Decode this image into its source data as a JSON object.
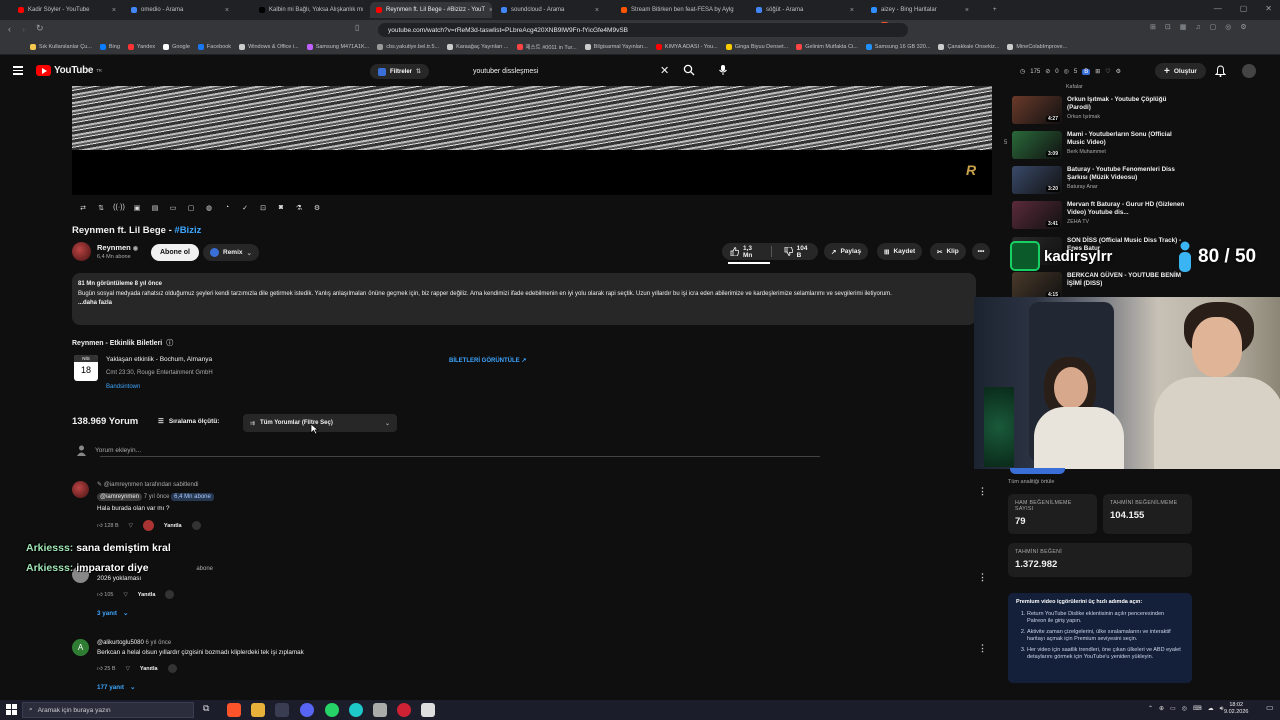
{
  "browser": {
    "tabs": [
      {
        "label": "Kadir Söyler - YouTube",
        "color": "#ff0000"
      },
      {
        "label": "omedio - Arama",
        "color": "#4285f4"
      },
      {
        "label": "Kalbin mi Bağlı, Yoksa Alışkanlık mı ?",
        "color": "#000000"
      },
      {
        "label": "Reynmen ft. Lil Bege - #Bizizz - YouT",
        "color": "#ff0000"
      },
      {
        "label": "soundcloud - Arama",
        "color": "#4285f4"
      },
      {
        "label": "Stream Bitirken ben feat-FESA by Aylg",
        "color": "#ff5500"
      },
      {
        "label": "söğüt - Arama",
        "color": "#4285f4"
      },
      {
        "label": "aizey - Bing Haritalar",
        "color": "#2f8fff"
      }
    ],
    "url": "youtube.com/watch?v=rReM3d-taswlist=PLbreAcg420XNB9lW9Fn-fYicGfe4M9vSB",
    "bookmarks": [
      {
        "label": "Sık Kullanılanlar Çu...",
        "color": "#f2c94c"
      },
      {
        "label": "Bing",
        "color": "#0a7cff"
      },
      {
        "label": "Yandex",
        "color": "#ff3333"
      },
      {
        "label": "Google",
        "color": "#ffffff"
      },
      {
        "label": "Facebook",
        "color": "#1877f2"
      },
      {
        "label": "Windows & Office i...",
        "color": "#cccccc"
      },
      {
        "label": "Samsung M471A1K...",
        "color": "#c060ff"
      },
      {
        "label": "cbs.yakutiye.bel.tr.5...",
        "color": "#999999"
      },
      {
        "label": "Karaağaç Yayınları ...",
        "color": "#cccccc"
      },
      {
        "label": "제스트 #0011 in Tur...",
        "color": "#ff4444"
      },
      {
        "label": "Bilgisarmal Yayınları...",
        "color": "#cccccc"
      },
      {
        "label": "KIMYA ADASI - You...",
        "color": "#ff0000"
      },
      {
        "label": "Ginga Biyuu Denset...",
        "color": "#ffcc00"
      },
      {
        "label": "Gelinim Mutfakta Ci...",
        "color": "#ff4444"
      },
      {
        "label": "Samsung 16 GB 320...",
        "color": "#1e90ff"
      },
      {
        "label": "Çanakkale Onsekiz...",
        "color": "#cccccc"
      },
      {
        "label": "MineColabImprove...",
        "color": "#cccccc"
      }
    ]
  },
  "youtube": {
    "logo_text": "YouTube",
    "logo_country": "TR",
    "filters_label": "Filtreler",
    "search_value": "youtuber dissleşmesi",
    "counts": [
      "175",
      "0",
      "5"
    ],
    "create_label": "Oluştur"
  },
  "video": {
    "title_main": "Reynmen ft. Lil Bege - ",
    "title_tag": "#Biziz",
    "channel": "Reynmen",
    "subscribers": "6,4 Mn abone",
    "subscribe_label": "Abone ol",
    "remix_label": "Remix",
    "likes": "1,3 Mn",
    "dislikes": "104 B",
    "share_label": "Paylaş",
    "save_label": "Kaydet",
    "clip_label": "Klip"
  },
  "description": {
    "meta": "81 Mn görüntüleme  8 yıl önce",
    "text": "Bugün sosyal medyada rahatsız olduğumuz şeyleri kendi tarzımızla dile getirmek istedik. Yanlış anlaşılmaları önüne geçmek için, biz rapper değiliz. Ama kendimizi ifade edebilmenin en iyi yolu olarak rapi seçtik. Uzun yıllardır bu işi icra eden abilerimize ve kardeşlerimize selamlarımı ve sevgilerimi iletiyorum.",
    "more": "...daha fazla"
  },
  "events": {
    "header": "Reynmen - Etkinlik Biletleri",
    "month": "NİS",
    "day": "18",
    "title": "Yaklaşan etkinlik - Bochum, Almanya",
    "time": "Cmt 23:30, Rouge Entertainment GmbH",
    "source": "Bandsintown",
    "tickets_label": "BİLETLERİ GÖRÜNTÜLE ↗"
  },
  "comments_section": {
    "count": "138.969 Yorum",
    "sort_label": "Sıralama ölçütü:",
    "filter_label": "Tüm Yorumlar (Filtre Seç)",
    "add_placeholder": "Yorum ekleyin..."
  },
  "comments": [
    {
      "pinned": "@iamreynmen tarafından sabitlendi",
      "author": "@iamreynmen",
      "time": "7 yıl önce",
      "badge": "6,4 Mn abone",
      "text": "Hala burada olan var mı ?",
      "likes": "128 B",
      "reply_label": "Yanıtla"
    },
    {
      "badge": "abone",
      "text": "2026 yoklaması",
      "likes": "105",
      "reply_label": "Yanıtla",
      "replies": "3 yanıt"
    },
    {
      "author": "@alikurtoglu5080",
      "time": "6 yıl önce",
      "text": "Berkcan a helal olsun yıllardır çizgisini bozmadı kliplerdeki tek işi zıplamak",
      "likes": "25 B",
      "reply_label": "Yanıtla",
      "replies": "177 yanıt"
    }
  ],
  "chat": [
    {
      "name": "Arkiesss:",
      "text": " sana demiştim kral"
    },
    {
      "name": "Arkiesss:",
      "text": " imparator diye"
    }
  ],
  "sidebar": {
    "top_channel": "Kafalar",
    "videos": [
      {
        "num": "",
        "title": "Orkun Işıtmak - Youtube Çöplüğü (Parodi)",
        "channel": "Orkun Işıtmak",
        "duration": "4:27",
        "color": "#6a3a2a"
      },
      {
        "num": "5",
        "title": "Mami - Youtuberların Sonu (Official Music Video)",
        "channel": "Berk Muhammet",
        "duration": "3:09",
        "color": "#2a6a3a"
      },
      {
        "num": "",
        "title": "Baturay - Youtube Fenomenleri Diss Şarkısı (Müzik Videosu)",
        "channel": "Baturay Anar",
        "duration": "3:20",
        "color": "#3a4a6a"
      },
      {
        "num": "",
        "title": "Mervan ft Baturay - Gurur HD (Gizlenen Video) Youtube dis...",
        "channel": "ZEHA TV",
        "duration": "3:41",
        "color": "#5a2a3a"
      },
      {
        "num": "",
        "title": "SON DİSS (Official Music Diss Track) - Enes Batur",
        "channel": "",
        "duration": "",
        "color": "#2a2a2a"
      },
      {
        "num": "",
        "title": "BERKCAN GÜVEN - YOUTUBE BENİM İŞİMİ (DISS)",
        "channel": "",
        "duration": "4:15",
        "color": "#4a3a2a"
      }
    ]
  },
  "overlay": {
    "streamer": "kadirsylrr",
    "score": "80 / 50"
  },
  "dislike_panel": {
    "hint": "Tüm analitiği örtüle",
    "raw_label": "HAM BEĞENİLMEME SAYISI",
    "raw_value": "79",
    "est_label": "TAHMİNİ BEĞENİLMEME",
    "est_value": "104.155",
    "est_like_label": "TAHMİNİ BEĞENİ",
    "est_like_value": "1.372.982",
    "premium_title": "Premium video içgörülerini üç hızlı adımda açın:",
    "steps": [
      "Return YouTube Dislike eklentisinin açılır penceresinden Patreon ile giriş yapın.",
      "Aktivite zaman çizelgelerini, ülke sıralamalarını ve interaktif haritayı açmak için Premium seviyesini seçin.",
      "Her video için saatlik trendleri, öne çıkan ülkeleri ve ABD eyalet detaylarını görmek için YouTube'u yeniden yükleyin."
    ]
  },
  "taskbar": {
    "search_placeholder": "Aramak için buraya yazın",
    "time": "18:02",
    "date": "9.02.2026"
  }
}
